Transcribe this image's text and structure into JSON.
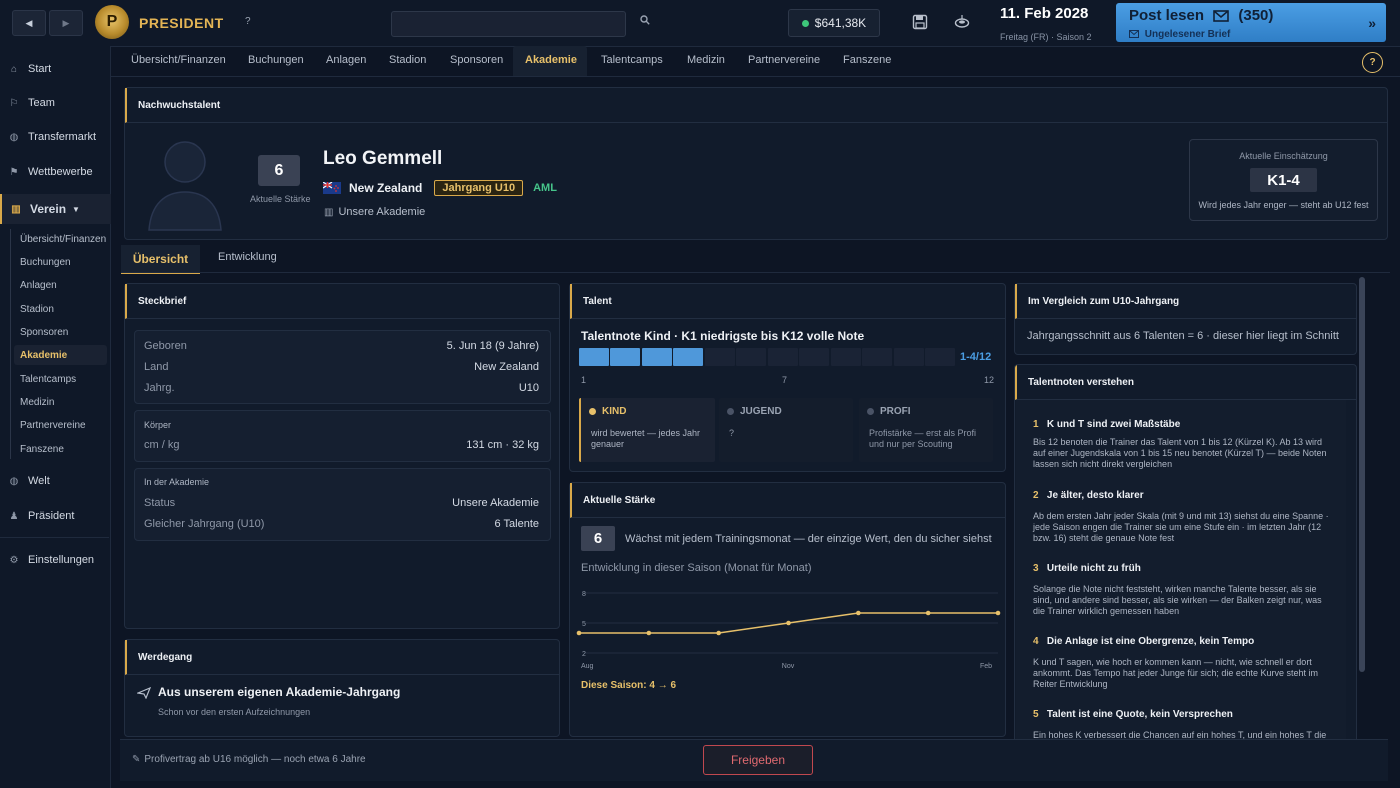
{
  "topbar": {
    "brand": "PRESIDENT",
    "help": "?",
    "money": "$641,38K",
    "date": "11. Feb 2028",
    "date_sub": "Freitag (FR) · Saison 2",
    "mail_title": "Post lesen",
    "mail_count": "(350)",
    "mail_sub": "Ungelesener Brief",
    "colors": {
      "accent": "#e7c06a",
      "mail": "#3b8fd8",
      "money_dot": "#3ec77a"
    }
  },
  "sidebar": {
    "items": [
      {
        "label": "Start",
        "icon": "home-icon"
      },
      {
        "label": "Team",
        "icon": "team-icon"
      },
      {
        "label": "Transfermarkt",
        "icon": "globe-icon"
      },
      {
        "label": "Wettbewerbe",
        "icon": "trophy-icon"
      },
      {
        "label": "Verein",
        "icon": "club-icon"
      },
      {
        "label": "Welt",
        "icon": "globe-icon"
      },
      {
        "label": "Präsident",
        "icon": "person-icon"
      },
      {
        "label": "Einstellungen",
        "icon": "gear-icon"
      }
    ],
    "sub": [
      "Übersicht/Finanzen",
      "Buchungen",
      "Anlagen",
      "Stadion",
      "Sponsoren",
      "Akademie",
      "Talentcamps",
      "Medizin",
      "Partnervereine",
      "Fanszene"
    ]
  },
  "tabs": [
    "Übersicht/Finanzen",
    "Buchungen",
    "Anlagen",
    "Stadion",
    "Sponsoren",
    "Akademie",
    "Talentcamps",
    "Medizin",
    "Partnervereine",
    "Fanszene"
  ],
  "header": {
    "section": "Nachwuchstalent",
    "strength": "6",
    "strength_label": "Aktuelle Stärke",
    "name": "Leo Gemmell",
    "country": "New Zealand",
    "year": "Jahrgang U10",
    "position": "AML",
    "academy": "Unsere Akademie",
    "rating_label": "Aktuelle Einschätzung",
    "rating": "K1-4",
    "rating_note": "Wird jedes Jahr enger — steht ab U12 fest"
  },
  "detail_tabs": [
    "Übersicht",
    "Entwicklung"
  ],
  "steckbrief": {
    "title": "Steckbrief",
    "rows": [
      {
        "label": "Geboren",
        "value": "5. Jun 18 (9 Jahre)"
      },
      {
        "label": "Land",
        "value": "New Zealand"
      },
      {
        "label": "Jahrg.",
        "value": "U10"
      }
    ],
    "body_title": "Körper",
    "body_label": "cm / kg",
    "body_value": "131 cm · 32 kg",
    "academy_title": "In der Akademie",
    "academy_rows": [
      {
        "label": "Status",
        "value": "Unsere Akademie"
      },
      {
        "label": "Gleicher Jahrgang (U10)",
        "value": "6 Talente"
      }
    ]
  },
  "werdegang": {
    "title": "Werdegang",
    "main": "Aus unserem eigenen Akademie-Jahrgang",
    "sub": "Schon vor den ersten Aufzeichnungen"
  },
  "talent": {
    "title": "Talent",
    "heading": "Talentnote Kind · K1 niedrigste bis K12 volle Note",
    "range_label": "1-4/12",
    "range_value": [
      1,
      4
    ],
    "scale_max": 12,
    "ticks": [
      "1",
      "7",
      "12"
    ],
    "cols": [
      {
        "label": "KIND",
        "text": "wird bewertet — jedes Jahr genauer",
        "active": true
      },
      {
        "label": "JUGEND",
        "text": "?",
        "active": false
      },
      {
        "label": "PROFI",
        "text": "Profistärke — erst als Profi und nur per Scouting",
        "active": false
      }
    ]
  },
  "staerke": {
    "title": "Aktuelle Stärke",
    "value": "6",
    "text": "Wächst mit jedem Trainingsmonat — der einzige Wert, den du sicher siehst",
    "chart_title": "Entwicklung in dieser Saison (Monat für Monat)",
    "season": "Diese Saison: 4 → 6"
  },
  "chart_data": {
    "type": "line",
    "x": [
      "Aug",
      "Sep",
      "Okt",
      "Nov",
      "Dez",
      "Jan",
      "Feb"
    ],
    "x_tick_labels": [
      "Aug",
      "Nov",
      "Feb"
    ],
    "values": [
      4,
      4,
      4,
      5,
      6,
      6,
      6
    ],
    "y_ticks": [
      2,
      5,
      8
    ],
    "ylim": [
      2,
      8
    ],
    "title": "Entwicklung in dieser Saison (Monat für Monat)",
    "color": "#e7c06a",
    "grid": true
  },
  "vergleich": {
    "title": "Im Vergleich zum U10-Jahrgang",
    "text": "Jahrgangsschnitt aus 6 Talenten = 6 · dieser hier liegt im Schnitt"
  },
  "talentnoten": {
    "title": "Talentnoten verstehen",
    "items": [
      {
        "num": "1",
        "head": "K und T sind zwei Maßstäbe",
        "body": "Bis 12 benoten die Trainer das Talent von 1 bis 12 (Kürzel K). Ab 13 wird auf einer Jugendskala von 1 bis 15 neu benotet (Kürzel T) — beide Noten lassen sich nicht direkt vergleichen"
      },
      {
        "num": "2",
        "head": "Je älter, desto klarer",
        "body": "Ab dem ersten Jahr jeder Skala (mit 9 und mit 13) siehst du eine Spanne · jede Saison engen die Trainer sie um eine Stufe ein · im letzten Jahr (12 bzw. 16) steht die genaue Note fest"
      },
      {
        "num": "3",
        "head": "Urteile nicht zu früh",
        "body": "Solange die Note nicht feststeht, wirken manche Talente besser, als sie sind, und andere sind besser, als sie wirken — der Balken zeigt nur, was die Trainer wirklich gemessen haben"
      },
      {
        "num": "4",
        "head": "Die Anlage ist eine Obergrenze, kein Tempo",
        "body": "K und T sagen, wie hoch er kommen kann — nicht, wie schnell er dort ankommt. Das Tempo hat jeder Junge für sich; die echte Kurve steht im Reiter Entwicklung"
      },
      {
        "num": "5",
        "head": "Talent ist eine Quote, kein Versprechen",
        "body": "Ein hohes K verbessert die Chancen auf ein hohes T, und ein hohes T die"
      }
    ]
  },
  "footer": {
    "note": "Profivertrag ab U16 möglich — noch etwa 6 Jahre",
    "release": "Freigeben"
  }
}
